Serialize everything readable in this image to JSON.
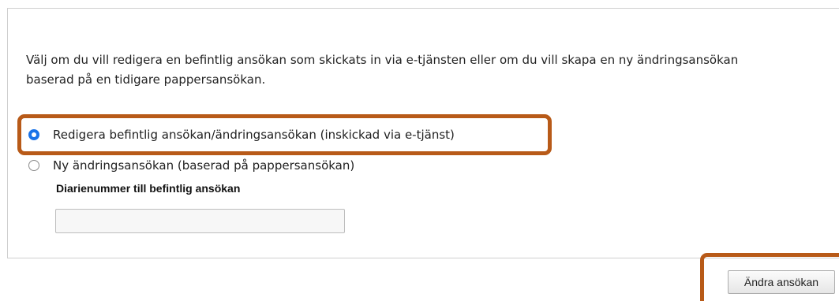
{
  "intro_text": "Välj om du vill redigera en befintlig ansökan som skickats in via e-tjänsten eller om du vill skapa en ny ändringsansökan baserad på en tidigare pappersansökan.",
  "options": [
    {
      "label": "Redigera befintlig ansökan/ändringsansökan (inskickad via e-tjänst)",
      "selected": true
    },
    {
      "label": "Ny ändringsansökan (baserad på pappersansökan)",
      "selected": false
    }
  ],
  "diarienummer": {
    "label": "Diarienummer till befintlig ansökan",
    "value": ""
  },
  "submit_label": "Ändra ansökan",
  "colors": {
    "highlight": "#b85a18",
    "radio_selected": "#1a73e8"
  }
}
